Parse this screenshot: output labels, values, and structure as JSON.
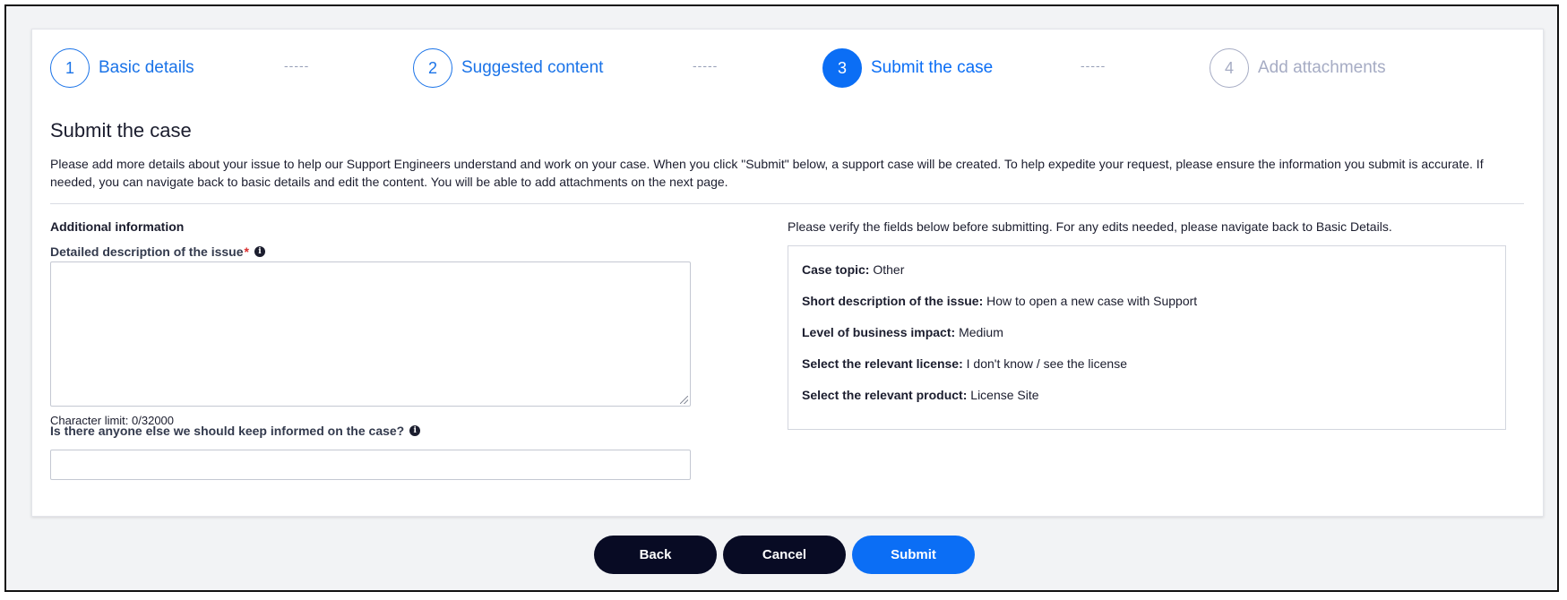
{
  "stepper": {
    "steps": [
      {
        "number": "1",
        "label": "Basic details",
        "state": "completed"
      },
      {
        "number": "2",
        "label": "Suggested content",
        "state": "completed"
      },
      {
        "number": "3",
        "label": "Submit the case",
        "state": "active"
      },
      {
        "number": "4",
        "label": "Add attachments",
        "state": "disabled"
      }
    ],
    "separator": "-----"
  },
  "page": {
    "title": "Submit the case",
    "intro": "Please add more details about your issue to help our Support Engineers understand and work on your case. When you click \"Submit\" below, a support case will be created. To help expedite your request, please ensure the information you submit is accurate. If needed, you can navigate back to basic details and edit the content. You will be able to add attachments on the next page."
  },
  "form": {
    "section_heading": "Additional information",
    "description_label": "Detailed description of the issue",
    "required_marker": "*",
    "description_value": "",
    "char_limit": "Character limit: 0/32000",
    "keep_informed_label": "Is there anyone else we should keep informed on the case?",
    "keep_informed_value": ""
  },
  "summary": {
    "note": "Please verify the fields below before submitting. For any edits needed, please navigate back to Basic Details.",
    "rows": [
      {
        "key": "Case topic:",
        "value": "Other"
      },
      {
        "key": "Short description of the issue:",
        "value": "How to open a new case with Support"
      },
      {
        "key": "Level of business impact:",
        "value": "Medium"
      },
      {
        "key": "Select the relevant license:",
        "value": "I don't know / see the license"
      },
      {
        "key": "Select the relevant product:",
        "value": "License Site"
      }
    ]
  },
  "actions": {
    "back": "Back",
    "cancel": "Cancel",
    "submit": "Submit"
  },
  "icons": {
    "info": "info-icon",
    "resize": "resize-grip-icon"
  },
  "colors": {
    "accent": "#0b6ef5",
    "dark_button": "#080b24",
    "disabled": "#a6acc4",
    "required": "#d92d2d"
  }
}
